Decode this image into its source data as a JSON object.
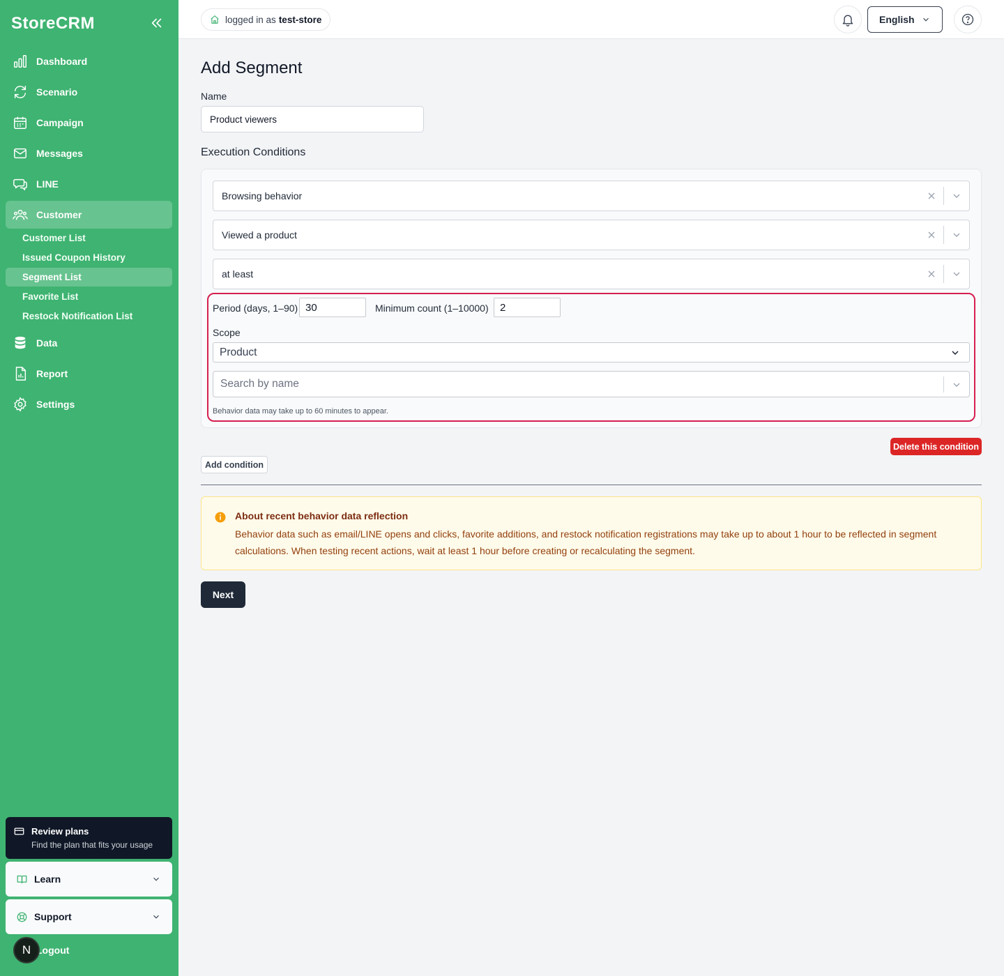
{
  "sidebar": {
    "brand": "StoreCRM",
    "nav": [
      {
        "label": "Dashboard",
        "icon": "bar-chart-icon"
      },
      {
        "label": "Scenario",
        "icon": "refresh-icon"
      },
      {
        "label": "Campaign",
        "icon": "calendar-icon"
      },
      {
        "label": "Messages",
        "icon": "mail-icon"
      },
      {
        "label": "LINE",
        "icon": "chat-icon"
      },
      {
        "label": "Customer",
        "icon": "users-icon",
        "active": true
      },
      {
        "label": "Data",
        "icon": "database-icon"
      },
      {
        "label": "Report",
        "icon": "file-chart-icon"
      },
      {
        "label": "Settings",
        "icon": "gear-icon"
      }
    ],
    "customer_sub": [
      {
        "label": "Customer List"
      },
      {
        "label": "Issued Coupon History"
      },
      {
        "label": "Segment List",
        "active": true
      },
      {
        "label": "Favorite List"
      },
      {
        "label": "Restock Notification List"
      }
    ],
    "plan_card": {
      "title": "Review plans",
      "subtitle": "Find the plan that fits your usage"
    },
    "learn": "Learn",
    "support": "Support",
    "logout": "Logout",
    "avatar_letter": "N"
  },
  "topbar": {
    "logged_in_prefix": "logged in as",
    "store": "test-store",
    "language": "English"
  },
  "main": {
    "title": "Add Segment",
    "name_label": "Name",
    "name_value": "Product viewers",
    "conditions_title": "Execution Conditions",
    "condition": {
      "category": "Browsing behavior",
      "action": "Viewed a product",
      "operator": "at least",
      "period_label": "Period (days, 1–90)",
      "period_value": "30",
      "min_count_label": "Minimum count (1–10000)",
      "min_count_value": "2",
      "scope_label": "Scope",
      "scope_value": "Product",
      "search_placeholder": "Search by name",
      "hint": "Behavior data may take up to 60 minutes to appear."
    },
    "delete_label": "Delete this condition",
    "add_label": "Add condition",
    "notice": {
      "title": "About recent behavior data reflection",
      "body": "Behavior data such as email/LINE opens and clicks, favorite additions, and restock notification registrations may take up to about 1 hour to be reflected in segment calculations. When testing recent actions, wait at least 1 hour before creating or recalculating the segment."
    },
    "next_label": "Next"
  },
  "colors": {
    "sidebar_bg": "#3fb371",
    "sidebar_active": "#67c38f",
    "highlight": "#d61f4f",
    "danger": "#dc2626",
    "primary_dark": "#1f2937"
  }
}
